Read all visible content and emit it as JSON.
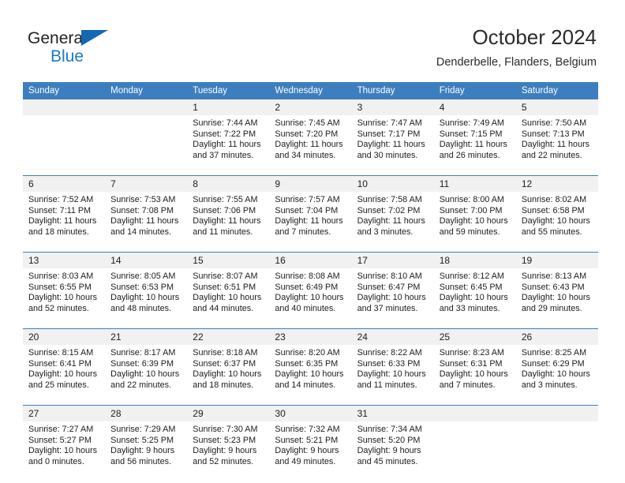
{
  "brand": {
    "line1": "General",
    "line2": "Blue",
    "triangle_color": "#1268b3",
    "blue_text_color": "#1b7ac4"
  },
  "header": {
    "title": "October 2024",
    "subtitle": "Denderbelle, Flanders, Belgium"
  },
  "theme": {
    "header_blue": "#3d7ebf",
    "daynum_band": "#f1f1f1",
    "cell_bg": "#ffffff",
    "text": "#1c1c1c"
  },
  "weekdays": [
    "Sunday",
    "Monday",
    "Tuesday",
    "Wednesday",
    "Thursday",
    "Friday",
    "Saturday"
  ],
  "weeks": [
    [
      {
        "day": "",
        "lines": []
      },
      {
        "day": "",
        "lines": []
      },
      {
        "day": "1",
        "lines": [
          "Sunrise: 7:44 AM",
          "Sunset: 7:22 PM",
          "Daylight: 11 hours",
          "and 37 minutes."
        ]
      },
      {
        "day": "2",
        "lines": [
          "Sunrise: 7:45 AM",
          "Sunset: 7:20 PM",
          "Daylight: 11 hours",
          "and 34 minutes."
        ]
      },
      {
        "day": "3",
        "lines": [
          "Sunrise: 7:47 AM",
          "Sunset: 7:17 PM",
          "Daylight: 11 hours",
          "and 30 minutes."
        ]
      },
      {
        "day": "4",
        "lines": [
          "Sunrise: 7:49 AM",
          "Sunset: 7:15 PM",
          "Daylight: 11 hours",
          "and 26 minutes."
        ]
      },
      {
        "day": "5",
        "lines": [
          "Sunrise: 7:50 AM",
          "Sunset: 7:13 PM",
          "Daylight: 11 hours",
          "and 22 minutes."
        ]
      }
    ],
    [
      {
        "day": "6",
        "lines": [
          "Sunrise: 7:52 AM",
          "Sunset: 7:11 PM",
          "Daylight: 11 hours",
          "and 18 minutes."
        ]
      },
      {
        "day": "7",
        "lines": [
          "Sunrise: 7:53 AM",
          "Sunset: 7:08 PM",
          "Daylight: 11 hours",
          "and 14 minutes."
        ]
      },
      {
        "day": "8",
        "lines": [
          "Sunrise: 7:55 AM",
          "Sunset: 7:06 PM",
          "Daylight: 11 hours",
          "and 11 minutes."
        ]
      },
      {
        "day": "9",
        "lines": [
          "Sunrise: 7:57 AM",
          "Sunset: 7:04 PM",
          "Daylight: 11 hours",
          "and 7 minutes."
        ]
      },
      {
        "day": "10",
        "lines": [
          "Sunrise: 7:58 AM",
          "Sunset: 7:02 PM",
          "Daylight: 11 hours",
          "and 3 minutes."
        ]
      },
      {
        "day": "11",
        "lines": [
          "Sunrise: 8:00 AM",
          "Sunset: 7:00 PM",
          "Daylight: 10 hours",
          "and 59 minutes."
        ]
      },
      {
        "day": "12",
        "lines": [
          "Sunrise: 8:02 AM",
          "Sunset: 6:58 PM",
          "Daylight: 10 hours",
          "and 55 minutes."
        ]
      }
    ],
    [
      {
        "day": "13",
        "lines": [
          "Sunrise: 8:03 AM",
          "Sunset: 6:55 PM",
          "Daylight: 10 hours",
          "and 52 minutes."
        ]
      },
      {
        "day": "14",
        "lines": [
          "Sunrise: 8:05 AM",
          "Sunset: 6:53 PM",
          "Daylight: 10 hours",
          "and 48 minutes."
        ]
      },
      {
        "day": "15",
        "lines": [
          "Sunrise: 8:07 AM",
          "Sunset: 6:51 PM",
          "Daylight: 10 hours",
          "and 44 minutes."
        ]
      },
      {
        "day": "16",
        "lines": [
          "Sunrise: 8:08 AM",
          "Sunset: 6:49 PM",
          "Daylight: 10 hours",
          "and 40 minutes."
        ]
      },
      {
        "day": "17",
        "lines": [
          "Sunrise: 8:10 AM",
          "Sunset: 6:47 PM",
          "Daylight: 10 hours",
          "and 37 minutes."
        ]
      },
      {
        "day": "18",
        "lines": [
          "Sunrise: 8:12 AM",
          "Sunset: 6:45 PM",
          "Daylight: 10 hours",
          "and 33 minutes."
        ]
      },
      {
        "day": "19",
        "lines": [
          "Sunrise: 8:13 AM",
          "Sunset: 6:43 PM",
          "Daylight: 10 hours",
          "and 29 minutes."
        ]
      }
    ],
    [
      {
        "day": "20",
        "lines": [
          "Sunrise: 8:15 AM",
          "Sunset: 6:41 PM",
          "Daylight: 10 hours",
          "and 25 minutes."
        ]
      },
      {
        "day": "21",
        "lines": [
          "Sunrise: 8:17 AM",
          "Sunset: 6:39 PM",
          "Daylight: 10 hours",
          "and 22 minutes."
        ]
      },
      {
        "day": "22",
        "lines": [
          "Sunrise: 8:18 AM",
          "Sunset: 6:37 PM",
          "Daylight: 10 hours",
          "and 18 minutes."
        ]
      },
      {
        "day": "23",
        "lines": [
          "Sunrise: 8:20 AM",
          "Sunset: 6:35 PM",
          "Daylight: 10 hours",
          "and 14 minutes."
        ]
      },
      {
        "day": "24",
        "lines": [
          "Sunrise: 8:22 AM",
          "Sunset: 6:33 PM",
          "Daylight: 10 hours",
          "and 11 minutes."
        ]
      },
      {
        "day": "25",
        "lines": [
          "Sunrise: 8:23 AM",
          "Sunset: 6:31 PM",
          "Daylight: 10 hours",
          "and 7 minutes."
        ]
      },
      {
        "day": "26",
        "lines": [
          "Sunrise: 8:25 AM",
          "Sunset: 6:29 PM",
          "Daylight: 10 hours",
          "and 3 minutes."
        ]
      }
    ],
    [
      {
        "day": "27",
        "lines": [
          "Sunrise: 7:27 AM",
          "Sunset: 5:27 PM",
          "Daylight: 10 hours",
          "and 0 minutes."
        ]
      },
      {
        "day": "28",
        "lines": [
          "Sunrise: 7:29 AM",
          "Sunset: 5:25 PM",
          "Daylight: 9 hours",
          "and 56 minutes."
        ]
      },
      {
        "day": "29",
        "lines": [
          "Sunrise: 7:30 AM",
          "Sunset: 5:23 PM",
          "Daylight: 9 hours",
          "and 52 minutes."
        ]
      },
      {
        "day": "30",
        "lines": [
          "Sunrise: 7:32 AM",
          "Sunset: 5:21 PM",
          "Daylight: 9 hours",
          "and 49 minutes."
        ]
      },
      {
        "day": "31",
        "lines": [
          "Sunrise: 7:34 AM",
          "Sunset: 5:20 PM",
          "Daylight: 9 hours",
          "and 45 minutes."
        ]
      },
      {
        "day": "",
        "lines": []
      },
      {
        "day": "",
        "lines": []
      }
    ]
  ]
}
